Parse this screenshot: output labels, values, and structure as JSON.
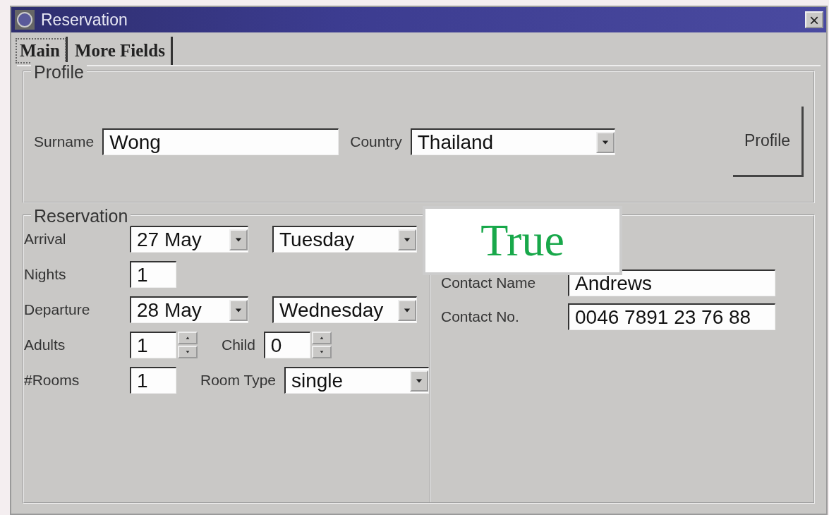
{
  "window": {
    "title": "Reservation",
    "close": "×"
  },
  "tabs": [
    {
      "label": "Main",
      "selected": true
    },
    {
      "label": "More Fields",
      "selected": false
    }
  ],
  "profile": {
    "title": "Profile",
    "fields": [
      {
        "kind": "text",
        "label": "Surname",
        "value": "Wong"
      },
      {
        "kind": "combo",
        "label": "Country",
        "value": "Thailand"
      }
    ],
    "button": "Profile"
  },
  "reservation": {
    "title": "Reservation",
    "rows": [
      {
        "label": "Arrival",
        "controls": [
          {
            "kind": "combo",
            "value": "27 May"
          },
          {
            "kind": "combo",
            "value": "Tuesday"
          }
        ]
      },
      {
        "label": "Nights",
        "controls": [
          {
            "kind": "text",
            "value": "1"
          }
        ]
      },
      {
        "label": "Departure",
        "controls": [
          {
            "kind": "combo",
            "value": "28 May"
          },
          {
            "kind": "combo",
            "value": "Wednesday"
          }
        ]
      },
      {
        "label": "Adults",
        "controls": [
          {
            "kind": "spinner",
            "value": "1"
          },
          {
            "kind": "spinner",
            "label": "Child",
            "value": "0"
          }
        ]
      },
      {
        "label": "#Rooms",
        "controls": [
          {
            "kind": "text",
            "value": "1"
          },
          {
            "kind": "combo",
            "label": "Room Type",
            "value": "single"
          }
        ]
      }
    ],
    "contact": [
      {
        "label": "Contact Name",
        "value": "Andrews"
      },
      {
        "label": "Contact No.",
        "value": "0046 7891 23 76 88"
      }
    ]
  },
  "overlay_label": "True"
}
